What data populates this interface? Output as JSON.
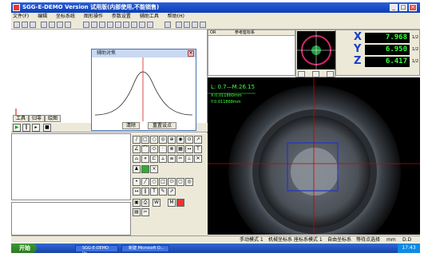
{
  "window": {
    "title": "SGG-E-DEMO  Version  试用版(内部使用,不能销售)",
    "minimize": "_",
    "maximize": "□",
    "close": "×"
  },
  "menu": [
    "文件(F)",
    "编辑",
    "坐标系统",
    "图形操作",
    "参数设置",
    "辅助工具",
    "帮助(H)"
  ],
  "tabs": [
    "工具",
    "归零",
    "绘图"
  ],
  "dialog": {
    "title": "辅助对焦",
    "close": "×",
    "confirm_label": "清除",
    "reset_label": "重置设点"
  },
  "measure_table": {
    "col1": "OR",
    "col2": "参考座标系"
  },
  "scope": {
    "zoom": "12",
    "ring_color": "#d4286a",
    "dot_color": "#1e9a3e"
  },
  "dro": {
    "x": {
      "axis": "X",
      "value": "7.968",
      "unit": "1/2"
    },
    "y": {
      "axis": "Y",
      "value": "6.950",
      "unit": "1/2"
    },
    "z": {
      "axis": "Z",
      "value": "6.417",
      "unit": "1/2"
    }
  },
  "camera_overlay": {
    "line1": "L: 0.7—M:26.15",
    "line2": "X:0.011860mm",
    "line3": "Y:0.011868mm",
    "crosshair_color": "#cc0000",
    "box_color": "#2233cc"
  },
  "status": {
    "mode": "手动模式 1",
    "machine": "机械坐标系",
    "coord": "座标系模式 1",
    "origin": "自由坐标系",
    "extra": "等待点选择",
    "unit": "mm",
    "value": "D.D"
  },
  "taskbar": {
    "start": "开始",
    "task1": "SGG-E-DEMO  Ve...",
    "task2": "新建 Microsoft O...",
    "clock": "17:43"
  },
  "colors": {
    "xp_blue": "#0a3fb5",
    "dro_green": "#3aff3a",
    "axis_blue": "#1a3ec4"
  }
}
